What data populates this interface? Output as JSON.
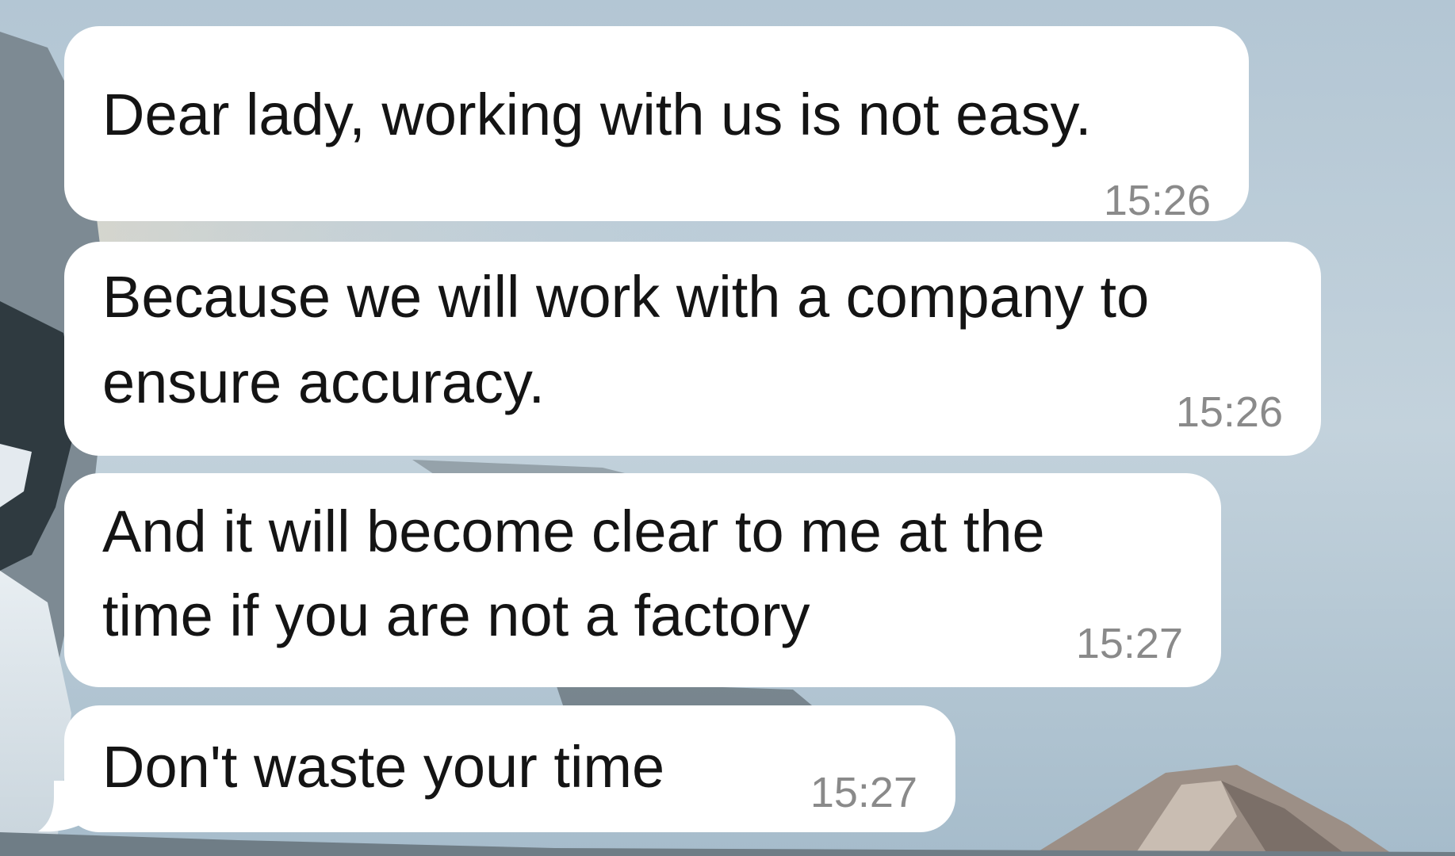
{
  "messages": [
    {
      "lines": [
        "Dear lady, working with us is not easy."
      ],
      "time": "15:26"
    },
    {
      "lines": [
        "Because we will work with a company to",
        "ensure accuracy."
      ],
      "time": "15:26"
    },
    {
      "lines": [
        "And it will become clear to me at the",
        "time if you are not a factory"
      ],
      "time": "15:27"
    },
    {
      "lines": [
        "Don't waste your time"
      ],
      "time": "15:27"
    }
  ],
  "colors": {
    "bubble": "#ffffff",
    "text": "#141414",
    "timestamp": "#8a8a8a",
    "sky": "#a9bfcf"
  },
  "icons": {
    "bubble_tail": "incoming-bubble-tail"
  }
}
